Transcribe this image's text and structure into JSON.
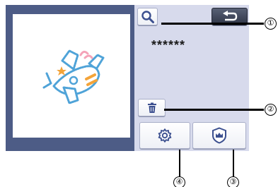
{
  "screen": {
    "masked_text": "******"
  },
  "icons": {
    "search": "magnifier-icon",
    "back": "return-arrow-icon",
    "delete": "trash-icon",
    "settings": "gear-icon",
    "premium": "crown-shield-icon"
  },
  "callouts": {
    "one": "①",
    "two": "②",
    "three": "③",
    "four": "④"
  },
  "colors": {
    "left_panel": "#4d5c86",
    "right_panel": "#d7daec",
    "back_button": "#3a4052",
    "icon_blue": "#3b4f8f"
  }
}
